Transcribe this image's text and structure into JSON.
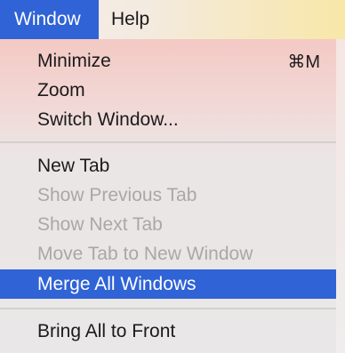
{
  "menubar": {
    "items": [
      {
        "label": "Window",
        "active": true
      },
      {
        "label": "Help",
        "active": false
      }
    ]
  },
  "window_menu": {
    "groups": [
      [
        {
          "label": "Minimize",
          "shortcut": "⌘M",
          "enabled": true
        },
        {
          "label": "Zoom",
          "shortcut": "",
          "enabled": true
        },
        {
          "label": "Switch Window...",
          "shortcut": "",
          "enabled": true
        }
      ],
      [
        {
          "label": "New Tab",
          "shortcut": "",
          "enabled": true
        },
        {
          "label": "Show Previous Tab",
          "shortcut": "",
          "enabled": false
        },
        {
          "label": "Show Next Tab",
          "shortcut": "",
          "enabled": false
        },
        {
          "label": "Move Tab to New Window",
          "shortcut": "",
          "enabled": false
        },
        {
          "label": "Merge All Windows",
          "shortcut": "",
          "enabled": true,
          "selected": true
        }
      ],
      [
        {
          "label": "Bring All to Front",
          "shortcut": "",
          "enabled": true
        }
      ]
    ]
  },
  "colors": {
    "selection": "#2f63d6",
    "disabled_text": "#a9a7a7",
    "text": "#1b1b1b"
  }
}
